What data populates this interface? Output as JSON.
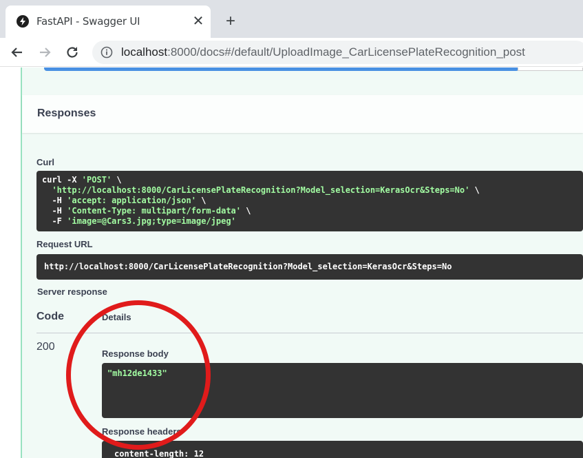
{
  "browser": {
    "tab_title": "FastAPI - Swagger UI",
    "new_tab_icon": "plus-icon",
    "close_tab_icon": "close-icon",
    "url_host": "localhost",
    "url_rest": ":8000/docs#/default/UploadImage_CarLicensePlateRecognition_post"
  },
  "page": {
    "responses_title": "Responses",
    "curl_label": "Curl",
    "curl": {
      "line1_cmd": "curl -X ",
      "line1_method": "'POST'",
      "line1_tail": " \\",
      "line2_url": "'http://localhost:8000/CarLicensePlateRecognition?Model_selection=KerasOcr&Steps=No'",
      "line2_tail": " \\",
      "line3_flag": "-H ",
      "line3_val": "'accept: application/json'",
      "line3_tail": " \\",
      "line4_flag": "-H ",
      "line4_val": "'Content-Type: multipart/form-data'",
      "line4_tail": " \\",
      "line5_flag": "-F ",
      "line5_val": "'image=@Cars3.jpg;type=image/jpeg'"
    },
    "request_url_label": "Request URL",
    "request_url": "http://localhost:8000/CarLicensePlateRecognition?Model_selection=KerasOcr&Steps=No",
    "server_response_label": "Server response",
    "table": {
      "code_header": "Code",
      "details_header": "Details",
      "status_code": "200",
      "response_body_label": "Response body",
      "response_body": "\"mh12de1433\"",
      "response_headers_label": "Response headers",
      "response_headers_first": "content-length: 12"
    }
  },
  "colors": {
    "post_green": "#49cc90",
    "annotation_red": "#e01b1b",
    "code_bg": "#333333"
  }
}
